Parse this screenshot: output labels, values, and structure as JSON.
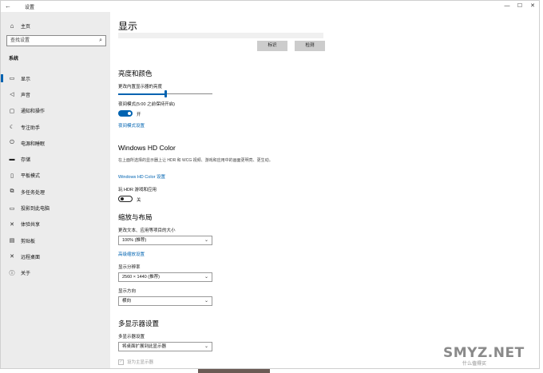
{
  "window": {
    "back_glyph": "←",
    "title": "设置",
    "controls": [
      "—",
      "☐",
      "✕"
    ]
  },
  "sidebar": {
    "home_label": "主页",
    "search_placeholder": "查找设置",
    "section_label": "系统",
    "items": [
      {
        "label": "显示",
        "icon": "display-icon",
        "glyph": "▭",
        "active": true
      },
      {
        "label": "声音",
        "icon": "speaker-icon",
        "glyph": "◁"
      },
      {
        "label": "通知和操作",
        "icon": "notification-icon",
        "glyph": "▢"
      },
      {
        "label": "专注助手",
        "icon": "moon-icon",
        "glyph": "☾"
      },
      {
        "label": "电源和睡眠",
        "icon": "power-icon",
        "glyph": "⏻"
      },
      {
        "label": "存储",
        "icon": "storage-icon",
        "glyph": "▬"
      },
      {
        "label": "平板模式",
        "icon": "tablet-icon",
        "glyph": "▯"
      },
      {
        "label": "多任务处理",
        "icon": "multitask-icon",
        "glyph": "⧉"
      },
      {
        "label": "投影到此电脑",
        "icon": "projector-icon",
        "glyph": "▭"
      },
      {
        "label": "体验共享",
        "icon": "share-icon",
        "glyph": "✕"
      },
      {
        "label": "剪贴板",
        "icon": "clipboard-icon",
        "glyph": "▤"
      },
      {
        "label": "远程桌面",
        "icon": "remote-desktop-icon",
        "glyph": "✕"
      },
      {
        "label": "关于",
        "icon": "info-icon",
        "glyph": "ⓘ"
      }
    ]
  },
  "main": {
    "title": "显示",
    "identify_label": "标识",
    "detect_label": "检测",
    "brightness": {
      "heading": "亮度和颜色",
      "label": "更改内置显示器的亮度",
      "level": 0.5
    },
    "night_light": {
      "label": "夜间模式(5:00 之前保持开启)",
      "state": "开",
      "on": true,
      "settings_link": "夜间模式设置"
    },
    "hdr": {
      "heading": "Windows HD Color",
      "desc": "在上面所选择的显示器上让 HDR 和 WCG 视频、游戏和应用中的画面更明亮、更生动。",
      "settings_link": "Windows HD Color 设置",
      "toggle_label": "玩 HDR 游戏和应用",
      "state": "关",
      "on": false
    },
    "scale": {
      "heading": "缩放与布局",
      "size_label": "更改文本、应用等项目的大小",
      "size_value": "100% (推荐)",
      "advanced_link": "高级缩放设置",
      "resolution_label": "显示分辨率",
      "resolution_value": "2560 × 1440 (推荐)",
      "orientation_label": "显示方向",
      "orientation_value": "横向"
    },
    "multi": {
      "heading": "多显示器设置",
      "label": "多显示器设置",
      "value": "将桌面扩展到此显示器",
      "checkbox_label": "设为主显示器",
      "checkbox_glyph": "✓"
    },
    "chevron_glyph": "⌄"
  },
  "watermark": {
    "main": "SMYZ.NET",
    "sub": "什么值得买"
  },
  "colors": {
    "accent": "#0063b1",
    "sidebar_bg": "#ececec",
    "button_bg": "#cccccc"
  }
}
